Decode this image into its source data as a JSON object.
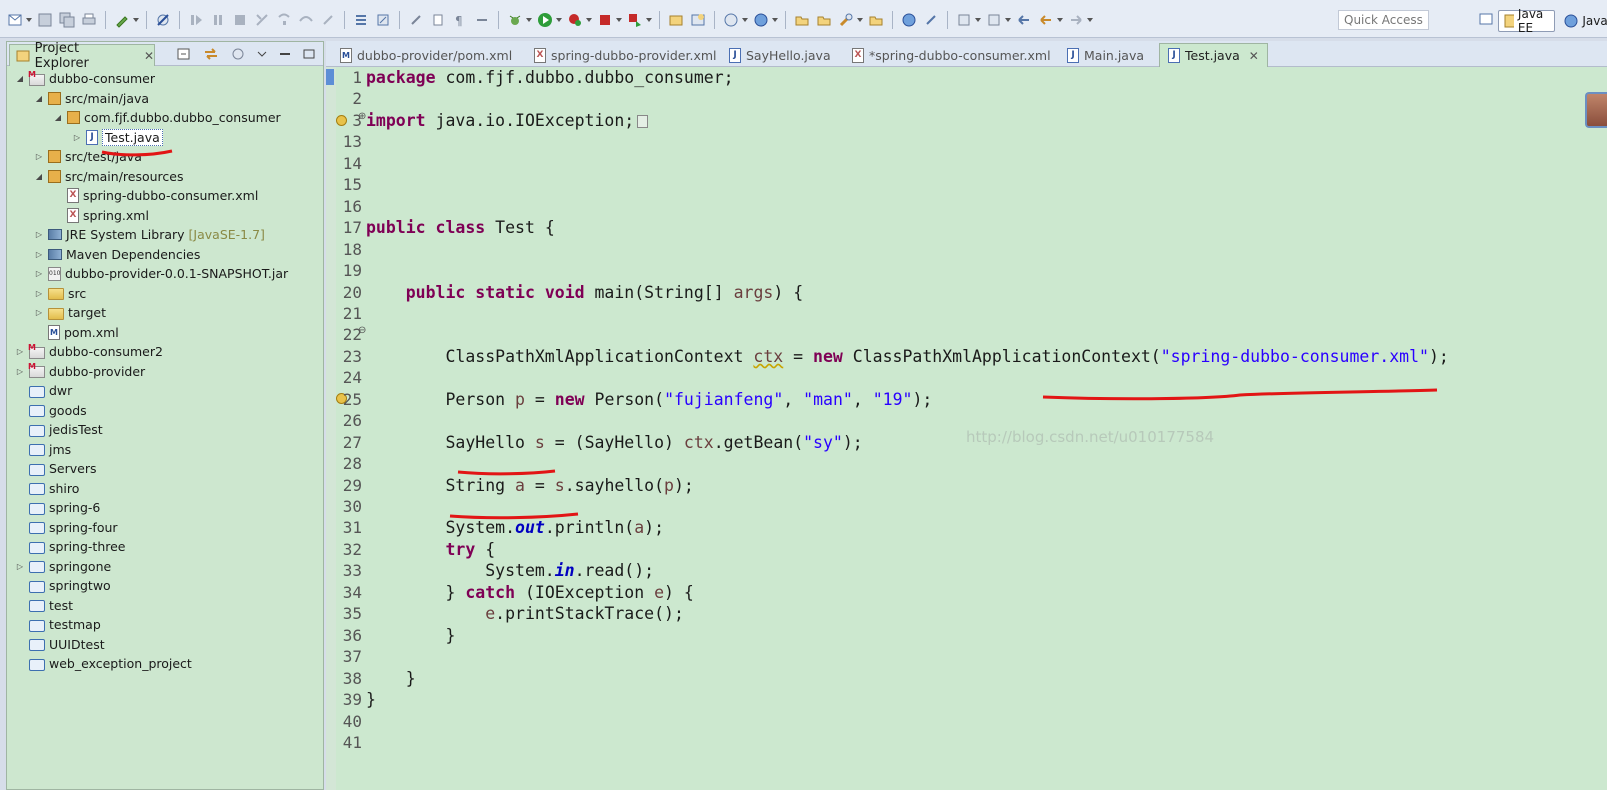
{
  "toolbar": {
    "quick_access": "Quick Access",
    "perspectives": [
      {
        "label": "Java EE",
        "active": true
      },
      {
        "label": "Java",
        "active": false
      }
    ]
  },
  "explorer": {
    "tab_label": "Project Explorer",
    "tree": [
      {
        "label": "dubbo-consumer",
        "icon": "maven-project-icon",
        "twisty": "open"
      },
      {
        "label": "src/main/java",
        "icon": "source-folder-icon",
        "twisty": "open"
      },
      {
        "label": "com.fjf.dubbo.dubbo_consumer",
        "icon": "package-icon",
        "twisty": "open"
      },
      {
        "label": "Test.java",
        "icon": "java-file-icon",
        "twisty": "closed",
        "selected": true
      },
      {
        "label": "src/test/java",
        "icon": "source-folder-icon",
        "twisty": "closed"
      },
      {
        "label": "src/main/resources",
        "icon": "source-folder-icon",
        "twisty": "open"
      },
      {
        "label": "spring-dubbo-consumer.xml",
        "icon": "xml-file-icon",
        "twisty": "none"
      },
      {
        "label": "spring.xml",
        "icon": "xml-file-icon",
        "twisty": "none"
      },
      {
        "label": "JRE System Library",
        "decoration": "[JavaSE-1.7]",
        "icon": "library-icon",
        "twisty": "closed"
      },
      {
        "label": "Maven Dependencies",
        "icon": "library-icon",
        "twisty": "closed"
      },
      {
        "label": "dubbo-provider-0.0.1-SNAPSHOT.jar",
        "icon": "jar-icon",
        "twisty": "closed"
      },
      {
        "label": "src",
        "icon": "folder-icon",
        "twisty": "closed"
      },
      {
        "label": "target",
        "icon": "folder-icon",
        "twisty": "closed"
      },
      {
        "label": "pom.xml",
        "icon": "pom-file-icon",
        "twisty": "none"
      },
      {
        "label": "dubbo-consumer2",
        "icon": "maven-project-icon",
        "twisty": "closed"
      },
      {
        "label": "dubbo-provider",
        "icon": "maven-project-icon",
        "twisty": "closed"
      },
      {
        "label": "dwr",
        "icon": "closed-project-icon",
        "twisty": "none"
      },
      {
        "label": "goods",
        "icon": "closed-project-icon",
        "twisty": "none"
      },
      {
        "label": "jedisTest",
        "icon": "closed-project-icon",
        "twisty": "none"
      },
      {
        "label": "jms",
        "icon": "closed-project-icon",
        "twisty": "none"
      },
      {
        "label": "Servers",
        "icon": "closed-project-icon",
        "twisty": "none"
      },
      {
        "label": "shiro",
        "icon": "closed-project-icon",
        "twisty": "none"
      },
      {
        "label": "spring-6",
        "icon": "closed-project-icon",
        "twisty": "none"
      },
      {
        "label": "spring-four",
        "icon": "closed-project-icon",
        "twisty": "none"
      },
      {
        "label": "spring-three",
        "icon": "closed-project-icon",
        "twisty": "none"
      },
      {
        "label": "springone",
        "icon": "spring-project-icon",
        "twisty": "closed"
      },
      {
        "label": "springtwo",
        "icon": "closed-project-icon",
        "twisty": "none"
      },
      {
        "label": "test",
        "icon": "closed-project-icon",
        "twisty": "none"
      },
      {
        "label": "testmap",
        "icon": "closed-project-icon",
        "twisty": "none"
      },
      {
        "label": "UUIDtest",
        "icon": "closed-project-icon",
        "twisty": "none"
      },
      {
        "label": "web_exception_project",
        "icon": "closed-project-icon",
        "twisty": "none"
      }
    ]
  },
  "editor": {
    "tabs": [
      {
        "label": "dubbo-provider/pom.xml",
        "icon": "pom-file-icon",
        "active": false
      },
      {
        "label": "spring-dubbo-provider.xml",
        "icon": "xml-file-icon",
        "active": false
      },
      {
        "label": "SayHello.java",
        "icon": "java-file-icon",
        "active": false
      },
      {
        "label": "*spring-dubbo-consumer.xml",
        "icon": "xml-file-icon",
        "active": false
      },
      {
        "label": "Main.java",
        "icon": "java-file-icon",
        "active": false
      },
      {
        "label": "Test.java",
        "icon": "java-file-icon",
        "active": true
      }
    ],
    "watermark": "http://blog.csdn.net/u010177584",
    "lines": [
      {
        "n": "1",
        "html": "<span class='kw'>package</span> com.fjf.dubbo.dubbo_consumer;"
      },
      {
        "n": "2",
        "html": ""
      },
      {
        "n": "3",
        "html": "<span class='kw'>import</span> java.io.IOException;<span class='foldbox'></span>"
      },
      {
        "n": "13",
        "html": ""
      },
      {
        "n": "14",
        "html": ""
      },
      {
        "n": "15",
        "html": ""
      },
      {
        "n": "16",
        "html": ""
      },
      {
        "n": "17",
        "html": "<span class='kw'>public class</span> Test {"
      },
      {
        "n": "18",
        "html": ""
      },
      {
        "n": "19",
        "html": ""
      },
      {
        "n": "20",
        "html": "    <span class='kw'>public static void</span> main(String[] <span class='var'>args</span>) {"
      },
      {
        "n": "21",
        "html": ""
      },
      {
        "n": "22",
        "html": ""
      },
      {
        "n": "23",
        "html": "        ClassPathXmlApplicationContext <span class='var squig'>ctx</span> = <span class='kw'>new</span> ClassPathXmlApplicationContext(<span class='str'>\"spring-dubbo-consumer.xml\"</span>);"
      },
      {
        "n": "24",
        "html": ""
      },
      {
        "n": "25",
        "html": "        Person <span class='var'>p</span> = <span class='kw'>new</span> Person(<span class='str'>\"fujianfeng\"</span>, <span class='str'>\"man\"</span>, <span class='str'>\"19\"</span>);"
      },
      {
        "n": "26",
        "html": ""
      },
      {
        "n": "27",
        "html": "        SayHello <span class='var'>s</span> = (SayHello) <span class='var'>ctx</span>.getBean(<span class='str'>\"sy\"</span>);"
      },
      {
        "n": "28",
        "html": ""
      },
      {
        "n": "29",
        "html": "        String <span class='var'>a</span> = <span class='var'>s</span>.sayhello(<span class='var'>p</span>);"
      },
      {
        "n": "30",
        "html": ""
      },
      {
        "n": "31",
        "html": "        System.<span class='fld'>out</span>.println(<span class='var'>a</span>);"
      },
      {
        "n": "32",
        "html": "        <span class='kw'>try</span> {"
      },
      {
        "n": "33",
        "html": "            System.<span class='fld'>in</span>.read();"
      },
      {
        "n": "34",
        "html": "        } <span class='kw'>catch</span> (IOException <span class='var'>e</span>) {"
      },
      {
        "n": "35",
        "html": "            <span class='var'>e</span>.printStackTrace();"
      },
      {
        "n": "36",
        "html": "        }"
      },
      {
        "n": "37",
        "html": ""
      },
      {
        "n": "38",
        "html": "    }"
      },
      {
        "n": "39",
        "html": "}"
      },
      {
        "n": "40",
        "html": ""
      },
      {
        "n": "41",
        "html": ""
      }
    ]
  }
}
